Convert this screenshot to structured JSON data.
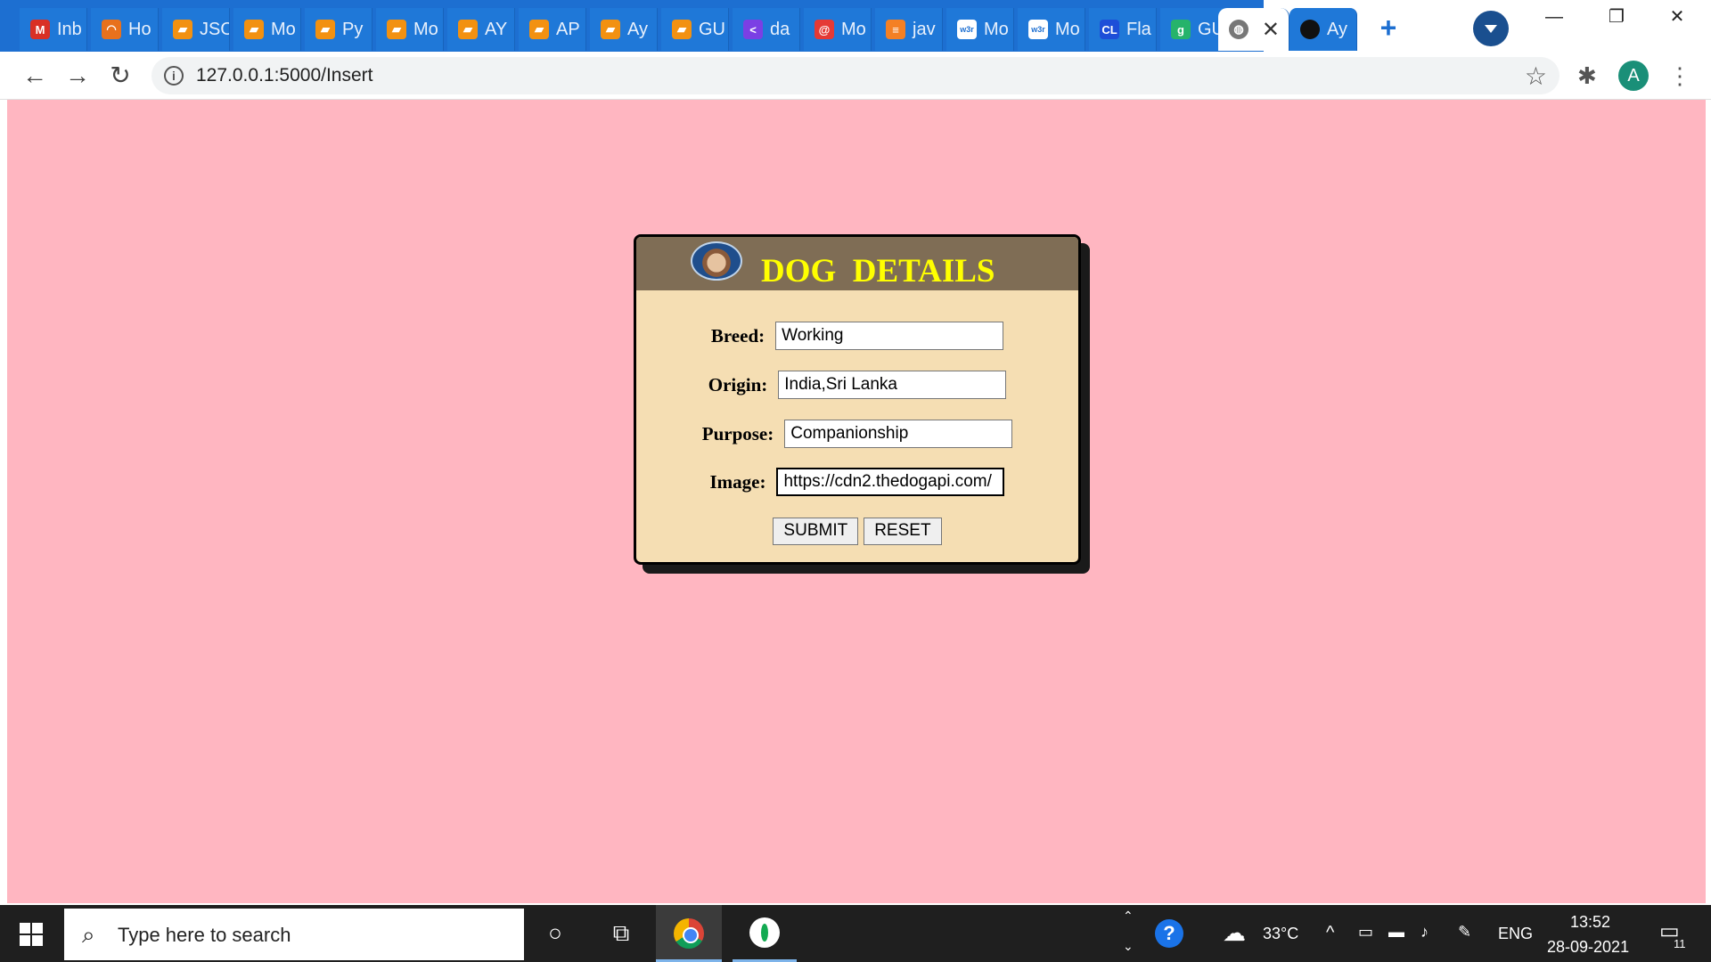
{
  "browser": {
    "tabs": [
      {
        "label": "Inb",
        "favicon": "gmail-icon",
        "color": "#d93025",
        "glyph": "M"
      },
      {
        "label": "Ho",
        "favicon": "arc-icon",
        "color": "#e8711c",
        "glyph": "◠"
      },
      {
        "label": "JSO",
        "favicon": "book-icon",
        "color": "#f29111",
        "glyph": "▰"
      },
      {
        "label": "Mo",
        "favicon": "book-icon",
        "color": "#f29111",
        "glyph": "▰"
      },
      {
        "label": "Py",
        "favicon": "book-icon",
        "color": "#f29111",
        "glyph": "▰"
      },
      {
        "label": "Mo",
        "favicon": "book-icon",
        "color": "#f29111",
        "glyph": "▰"
      },
      {
        "label": "AY",
        "favicon": "book-icon",
        "color": "#f29111",
        "glyph": "▰"
      },
      {
        "label": "AP",
        "favicon": "book-icon",
        "color": "#f29111",
        "glyph": "▰"
      },
      {
        "label": "Ay",
        "favicon": "book-icon",
        "color": "#f29111",
        "glyph": "▰"
      },
      {
        "label": "GU",
        "favicon": "book-icon",
        "color": "#f29111",
        "glyph": "▰"
      },
      {
        "label": "da",
        "favicon": "chevron-icon",
        "color": "#7b3fe4",
        "glyph": "<"
      },
      {
        "label": "Mo",
        "favicon": "codecademy-icon",
        "color": "#e53935",
        "glyph": "@"
      },
      {
        "label": "jav",
        "favicon": "stackoverflow-icon",
        "color": "#f48024",
        "glyph": "≡"
      },
      {
        "label": "Mo",
        "favicon": "w3schools-icon",
        "color": "#ffffff",
        "glyph": "w3r"
      },
      {
        "label": "Mo",
        "favicon": "w3schools-icon",
        "color": "#ffffff",
        "glyph": "w3r"
      },
      {
        "label": "Fla",
        "favicon": "cl-icon",
        "color": "#1d4ed8",
        "glyph": "CL"
      },
      {
        "label": "GU",
        "favicon": "g-circle-icon",
        "color": "#26b36b",
        "glyph": "g"
      }
    ],
    "active_tab_close": "✕",
    "github_tab": {
      "label": "Ay",
      "favicon": "github-icon",
      "glyph": "●"
    },
    "new_tab": "+",
    "window_controls": {
      "minimize": "—",
      "restore": "❐",
      "close": "✕"
    },
    "nav": {
      "back": "←",
      "forward": "→",
      "reload": "↻"
    },
    "url": "127.0.0.1:5000/Insert",
    "info_glyph": "i",
    "bookmark_glyph": "☆",
    "extensions_glyph": "✱",
    "profile_initial": "A",
    "menu_glyph": "⋮"
  },
  "form": {
    "title": "DOG  DETAILS",
    "fields": {
      "breed": {
        "label": "Breed:",
        "value": "Working"
      },
      "origin": {
        "label": "Origin:",
        "value": "India,Sri Lanka"
      },
      "purpose": {
        "label": "Purpose:",
        "value": "Companionship"
      },
      "image": {
        "label": "Image:",
        "value": "https://cdn2.thedogapi.com/"
      }
    },
    "submit_label": "SUBMIT",
    "reset_label": "RESET"
  },
  "taskbar": {
    "search_placeholder": "Type here to search",
    "temperature": "33°C",
    "language": "ENG",
    "time": "13:52",
    "date": "28-09-2021",
    "notification_count": "11",
    "help_glyph": "?"
  }
}
